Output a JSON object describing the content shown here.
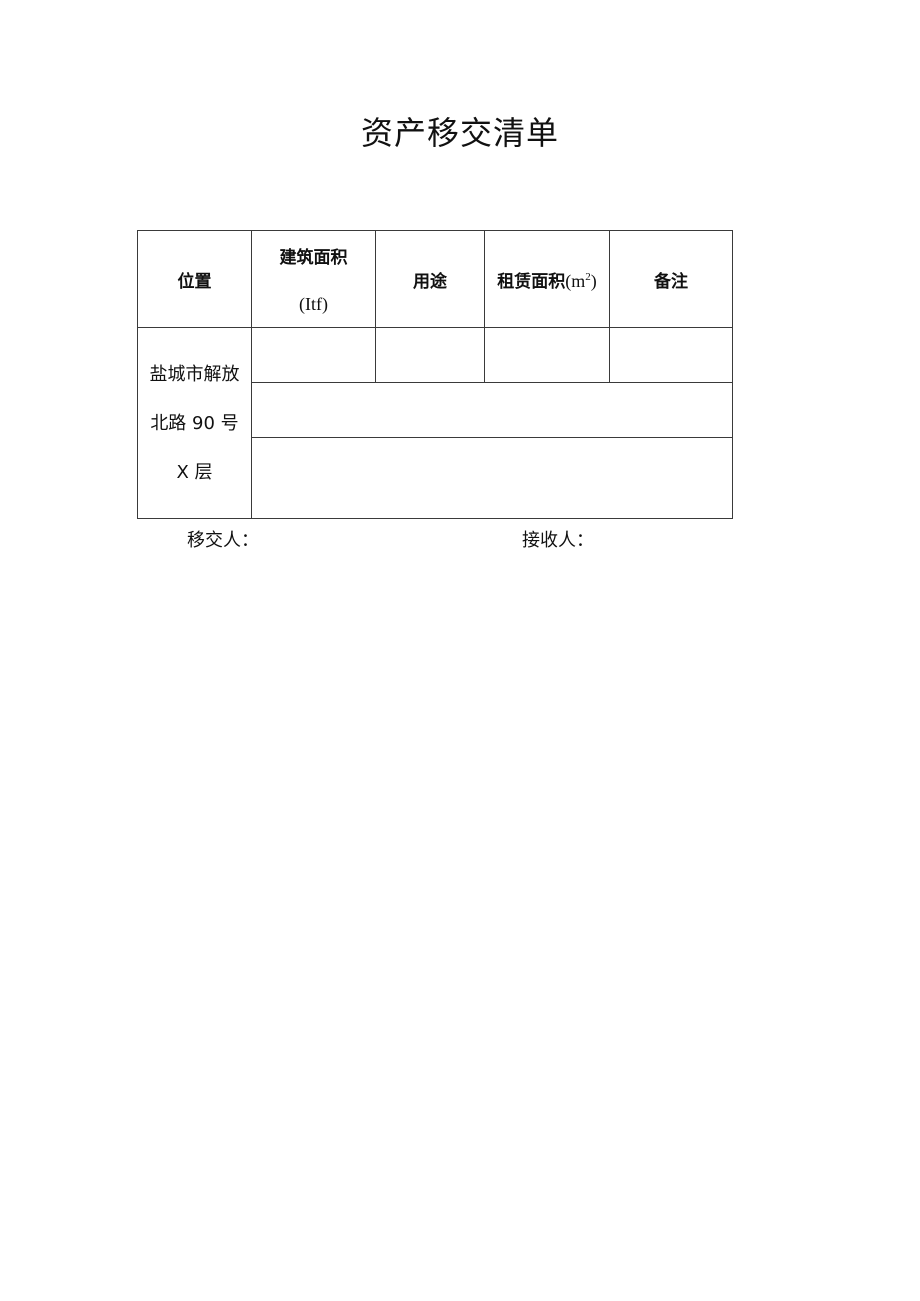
{
  "document": {
    "title": "资产移交清单",
    "table": {
      "headers": [
        {
          "label": "位置"
        },
        {
          "label": "建筑面积",
          "unit": "(Itf)"
        },
        {
          "label": "用途"
        },
        {
          "label": "租赁面积",
          "unit_prefix": "(m",
          "unit_sup": "2",
          "unit_suffix": ")"
        },
        {
          "label": "备注"
        }
      ],
      "location_lines": [
        "盐城市解放",
        "北路 90 号",
        "X 层"
      ],
      "rows": [
        {
          "building_area": "",
          "usage": "",
          "lease_area": "",
          "remarks": ""
        },
        {
          "merged": ""
        },
        {
          "merged": ""
        }
      ]
    },
    "signatures": {
      "transferor_label": "移交人：",
      "receiver_label": "接收人："
    }
  }
}
